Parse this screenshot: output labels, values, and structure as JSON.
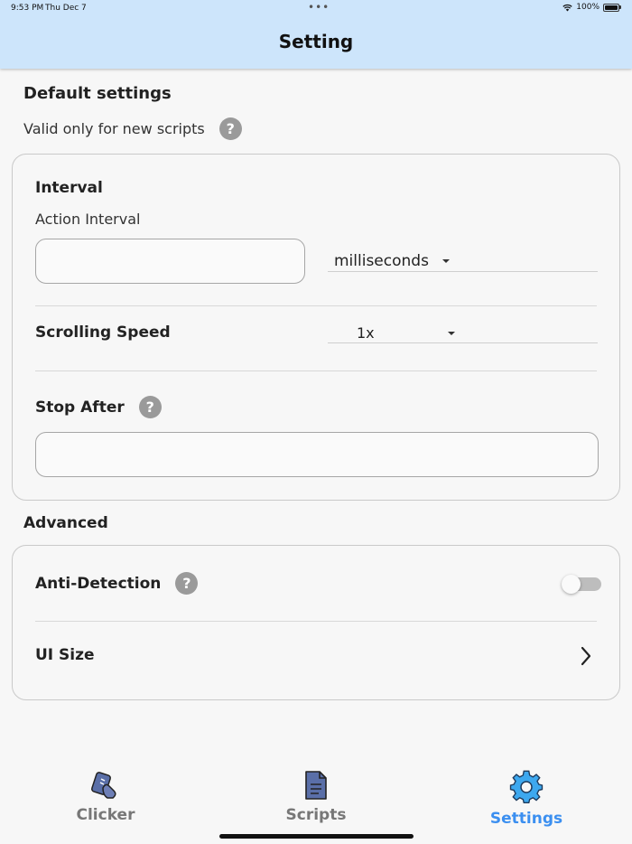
{
  "status_bar": {
    "time": "9:53 PM",
    "date": "Thu Dec 7",
    "battery": "100%"
  },
  "header": {
    "title": "Setting"
  },
  "default_settings": {
    "title": "Default settings",
    "subtitle": "Valid only for new scripts",
    "interval": {
      "title": "Interval",
      "label": "Action Interval",
      "value": "",
      "unit": "milliseconds"
    },
    "scrolling_speed": {
      "label": "Scrolling Speed",
      "value": "1x"
    },
    "stop_after": {
      "label": "Stop After",
      "value": ""
    }
  },
  "advanced": {
    "title": "Advanced",
    "anti_detection": {
      "label": "Anti-Detection",
      "enabled": false
    },
    "ui_size": {
      "label": "UI Size"
    }
  },
  "tabs": [
    {
      "label": "Clicker",
      "icon": "clicker-icon",
      "active": false
    },
    {
      "label": "Scripts",
      "icon": "document-icon",
      "active": false
    },
    {
      "label": "Settings",
      "icon": "gear-icon",
      "active": true
    }
  ],
  "colors": {
    "header_bg": "#cde5fb",
    "accent": "#3b8ff0",
    "help_icon": "#9a9a9a"
  }
}
